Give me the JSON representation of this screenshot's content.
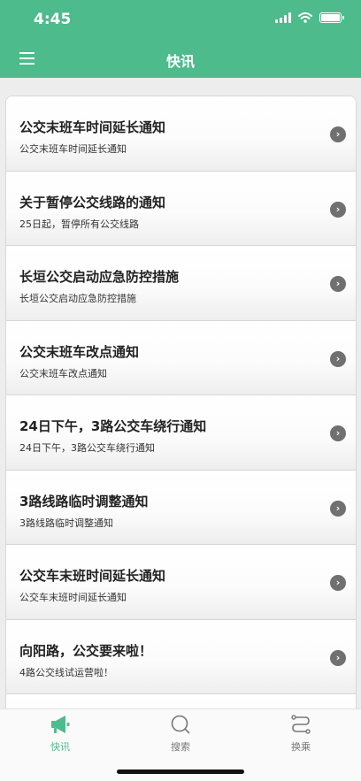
{
  "status_bar": {
    "time": "4:45"
  },
  "nav": {
    "title": "快讯"
  },
  "items": [
    {
      "title": "公交末班车时间延长通知",
      "subtitle": "公交末班车时间延长通知"
    },
    {
      "title": "关于暂停公交线路的通知",
      "subtitle": "25日起，暂停所有公交线路"
    },
    {
      "title": "长垣公交启动应急防控措施",
      "subtitle": "长垣公交启动应急防控措施"
    },
    {
      "title": "公交末班车改点通知",
      "subtitle": "公交末班车改点通知"
    },
    {
      "title": "24日下午，3路公交车绕行通知",
      "subtitle": "24日下午，3路公交车绕行通知"
    },
    {
      "title": "3路线路临时调整通知",
      "subtitle": "3路线路临时调整通知"
    },
    {
      "title": "公交车末班时间延长通知",
      "subtitle": "公交车末班时间延长通知"
    },
    {
      "title": "向阳路，公交要来啦！",
      "subtitle": "4路公交线试运营啦！"
    },
    {
      "title": "",
      "subtitle": ""
    }
  ],
  "tabs": [
    {
      "label": "快讯",
      "icon": "megaphone-icon",
      "active": true
    },
    {
      "label": "搜索",
      "icon": "search-icon",
      "active": false
    },
    {
      "label": "换乘",
      "icon": "transfer-icon",
      "active": false
    }
  ],
  "colors": {
    "accent": "#4dbb8c",
    "chevron": "#707070"
  }
}
